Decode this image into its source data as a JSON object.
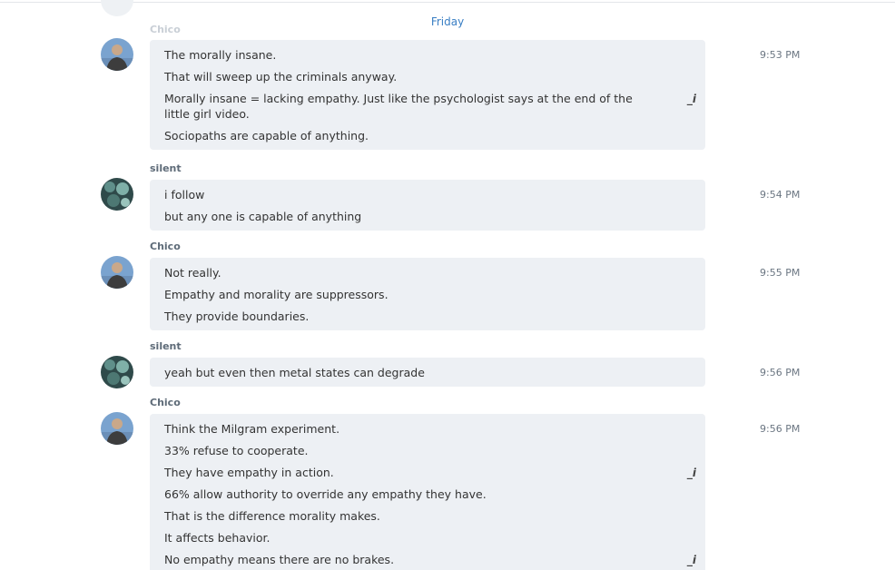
{
  "date_separator": "Friday",
  "partial_top_sender": "Chico",
  "messages": [
    {
      "sender": "",
      "avatar": "chico-avatar",
      "time": "9:53 PM",
      "lines": [
        {
          "text": "The morally insane."
        },
        {
          "text": "That will sweep up the criminals anyway."
        },
        {
          "text": "Morally insane = lacking empathy.  Just like the psychologist says at the end of the little girl video.",
          "edited": true
        },
        {
          "text": "Sociopaths are capable of anything."
        }
      ]
    },
    {
      "sender": "silent",
      "avatar": "silent-avatar",
      "time": "9:54 PM",
      "lines": [
        {
          "text": "i follow"
        },
        {
          "text": "but any one is capable of anything"
        }
      ]
    },
    {
      "sender": "Chico",
      "avatar": "chico-avatar",
      "time": "9:55 PM",
      "lines": [
        {
          "text": "Not really."
        },
        {
          "text": "Empathy and morality are suppressors."
        },
        {
          "text": "They provide boundaries."
        }
      ]
    },
    {
      "sender": "silent",
      "avatar": "silent-avatar",
      "time": "9:56 PM",
      "lines": [
        {
          "text": "yeah but even then metal states can degrade"
        }
      ]
    },
    {
      "sender": "Chico",
      "avatar": "chico-avatar",
      "time": "9:56 PM",
      "lines": [
        {
          "text": "Think the Milgram experiment."
        },
        {
          "text": "33% refuse to cooperate."
        },
        {
          "text": "They have empathy in action.",
          "edited": true
        },
        {
          "text": "66% allow authority to override any empathy they have."
        },
        {
          "text": "That is the difference morality makes."
        },
        {
          "text": "It affects behavior."
        },
        {
          "text": "No empathy means there are no brakes.",
          "edited": true
        }
      ]
    }
  ],
  "edit_icon_glyph": "_i",
  "colors": {
    "bubble": "#edf0f4",
    "date": "#3a7fc4",
    "sender": "#5e6b78",
    "time": "#6b7682"
  }
}
